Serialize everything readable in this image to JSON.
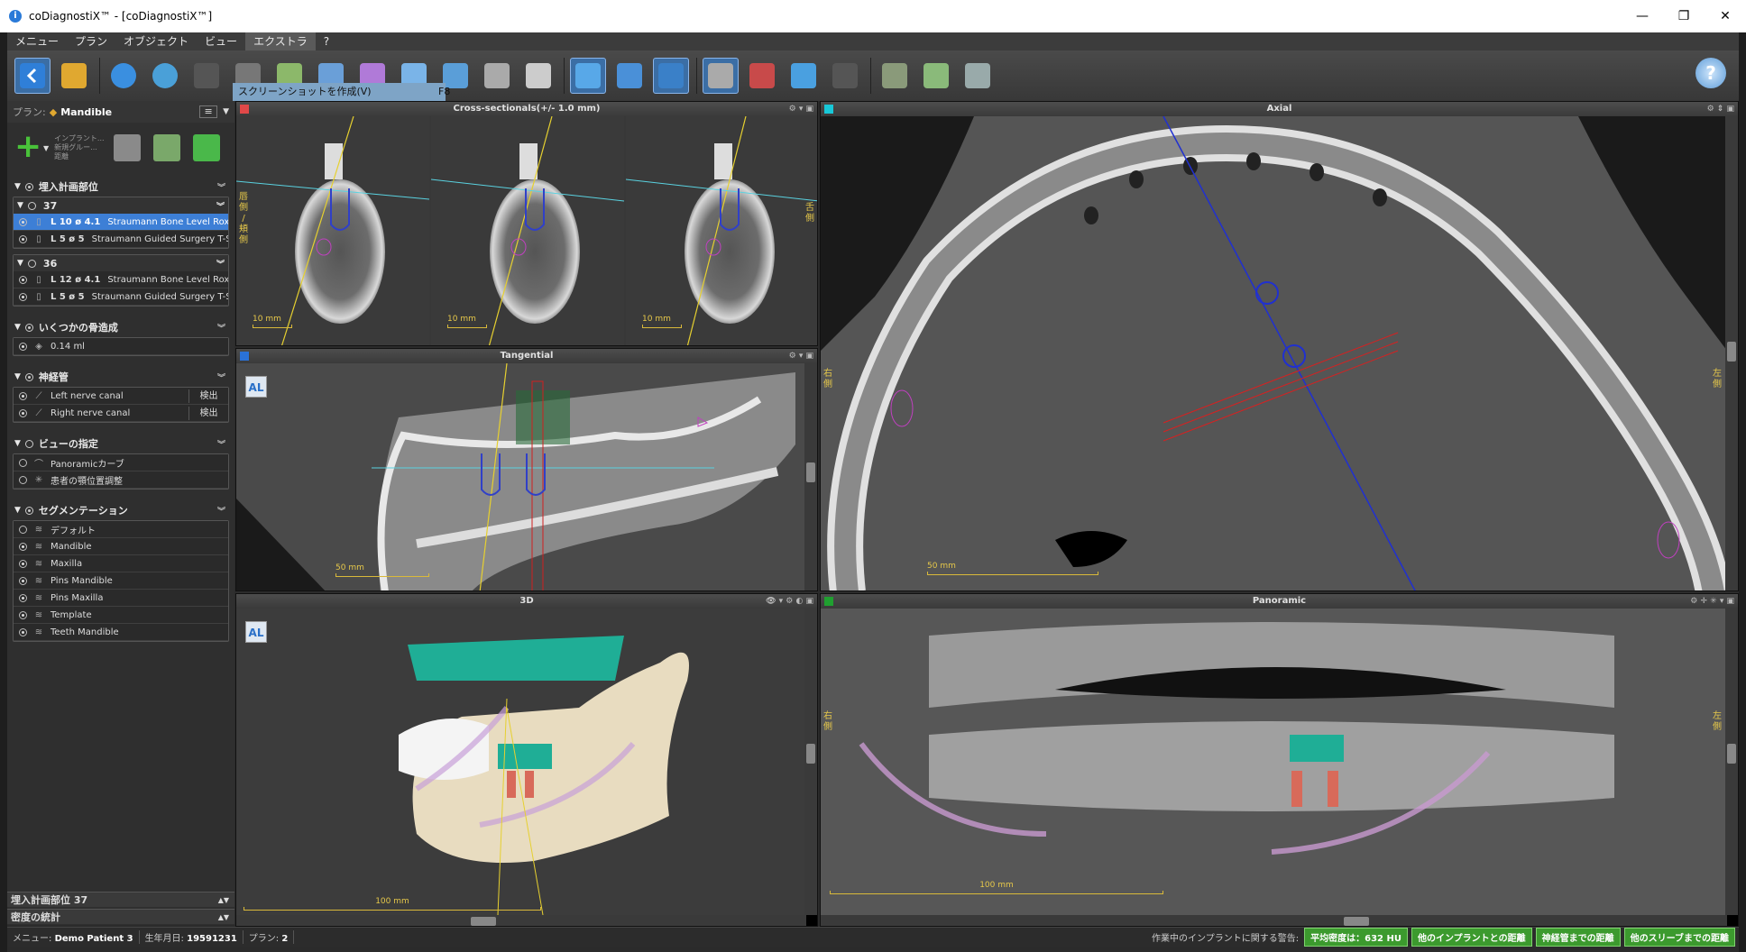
{
  "window": {
    "title": "coDiagnostiX™ - [coDiagnostiX™]",
    "buttons": [
      "—",
      "❐",
      "✕"
    ]
  },
  "menu": [
    "メニュー",
    "プラン",
    "オブジェクト",
    "ビュー",
    "エクストラ",
    "?"
  ],
  "tooltip": {
    "label": "スクリーンショットを作成(V)",
    "shortcut": "F8"
  },
  "plan": {
    "label": "プラン:",
    "name": "Mandible",
    "add_tools_text": [
      "インプラント...",
      "新規グルー...",
      "距離"
    ]
  },
  "sections": {
    "implant_sites": {
      "title": "埋入計画部位",
      "groups": [
        {
          "id": "37",
          "rows": [
            {
              "spec": "L 10  ø 4.1",
              "name": "Straumann Bone Level Roxolid® ...",
              "selected": true
            },
            {
              "spec": "L 5  ø 5",
              "name": "Straumann Guided Surgery T-Sleeve",
              "selected": false
            }
          ]
        },
        {
          "id": "36",
          "rows": [
            {
              "spec": "L 12  ø 4.1",
              "name": "Straumann Bone Level Roxolid® ...",
              "selected": false
            },
            {
              "spec": "L 5  ø 5",
              "name": "Straumann Guided Surgery T-Sleeve",
              "selected": false
            }
          ]
        }
      ]
    },
    "bone_augmentation": {
      "title": "いくつかの骨造成",
      "rows": [
        "0.14 ml"
      ]
    },
    "nerve_canal": {
      "title": "神経管",
      "rows": [
        {
          "label": "Left nerve canal",
          "button": "検出"
        },
        {
          "label": "Right nerve canal",
          "button": "検出"
        }
      ]
    },
    "view_settings": {
      "title": "ビューの指定",
      "rows": [
        "Panoramicカーブ",
        "患者の顎位置調整"
      ]
    },
    "segmentation": {
      "title": "セグメンテーション",
      "rows": [
        "デフォルト",
        "Mandible",
        "Maxilla",
        "Pins Mandible",
        "Pins Maxilla",
        "Template",
        "Teeth Mandible"
      ]
    }
  },
  "bottom_bars": [
    "埋入計画部位 37",
    "密度の統計"
  ],
  "views": {
    "cross": {
      "title": "Cross-sectionals(+/- 1.0 mm)",
      "scale": "10 mm",
      "left_label": "唇側 / 頬側",
      "right_label": "舌側",
      "color": "#e04848"
    },
    "axial": {
      "title": "Axial",
      "scale": "50 mm",
      "left_label": "右側",
      "right_label": "左側",
      "color": "#18c8d8"
    },
    "tangential": {
      "title": "Tangential",
      "scale": "50 mm",
      "color": "#2a72d8"
    },
    "three_d": {
      "title": "3D",
      "scale": "100 mm"
    },
    "panoramic": {
      "title": "Panoramic",
      "scale": "100 mm",
      "left_label": "右側",
      "right_label": "左側",
      "color": "#20a030"
    }
  },
  "status": {
    "patient_label": "メニュー:",
    "patient": "Demo Patient 3",
    "dob_label": "生年月日:",
    "dob": "19591231",
    "plan_label": "プラン:",
    "plan": "2",
    "warning": "作業中のインプラントに関する警告:",
    "buttons": [
      "平均密度は：632 HU",
      "他のインプラントとの距離",
      "神経管までの距離",
      "他のスリーブまでの距離"
    ]
  }
}
